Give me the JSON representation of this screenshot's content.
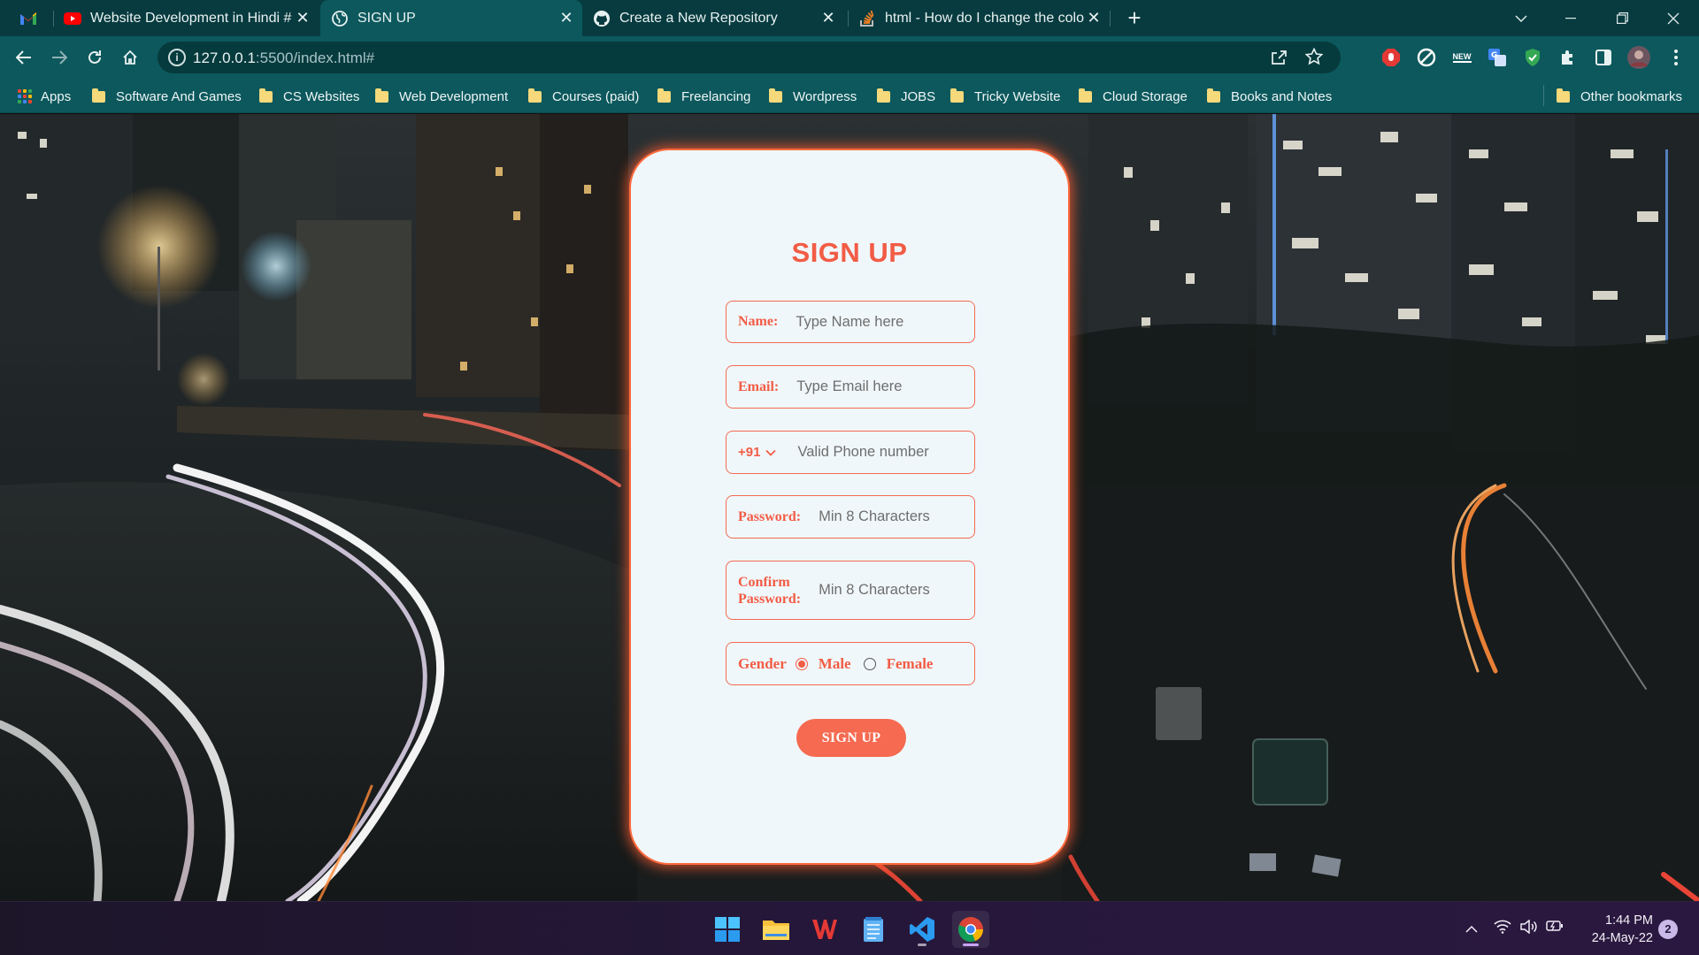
{
  "browser": {
    "tabs": [
      {
        "title": "Website Development in Hindi #",
        "icon": "youtube-icon",
        "active": false
      },
      {
        "title": "SIGN UP",
        "icon": "globe-icon",
        "active": true
      },
      {
        "title": "Create a New Repository",
        "icon": "github-icon",
        "active": false
      },
      {
        "title": "html - How do I change the colo",
        "icon": "stackoverflow-icon",
        "active": false
      }
    ],
    "url_host": "127.0.0.1",
    "url_path": ":5500/index.html#",
    "extension_badge": "NEW"
  },
  "bookmarks": {
    "apps_label": "Apps",
    "items": [
      "Software And Games",
      "CS Websites",
      "Web Development",
      "Courses (paid)",
      "Freelancing",
      "Wordpress",
      "JOBS",
      "Tricky Website",
      "Cloud Storage",
      "Books and Notes"
    ],
    "other": "Other bookmarks"
  },
  "form": {
    "title": "SIGN UP",
    "name_label": "Name:",
    "name_placeholder": "Type Name here",
    "email_label": "Email:",
    "email_placeholder": "Type Email here",
    "country_code": "+91",
    "phone_placeholder": "Valid Phone number",
    "password_label": "Password:",
    "password_placeholder": "Min 8 Characters",
    "confirm_label_1": "Confirm",
    "confirm_label_2": "Password:",
    "confirm_placeholder": "Min 8 Characters",
    "gender_label": "Gender",
    "gender_options": [
      "Male",
      "Female"
    ],
    "gender_selected": "Male",
    "submit_label": "SIGN UP"
  },
  "taskbar": {
    "apps": [
      "windows-start-icon",
      "file-explorer-icon",
      "wps-office-icon",
      "notepad-icon",
      "vscode-icon",
      "chrome-icon"
    ],
    "time": "1:44 PM",
    "date": "24-May-22",
    "notification_count": "2"
  },
  "colors": {
    "accent": "#f25c45",
    "card_bg": "#f0f7fa",
    "browser_frame": "#0c585d",
    "tabstrip": "#073b3f"
  }
}
